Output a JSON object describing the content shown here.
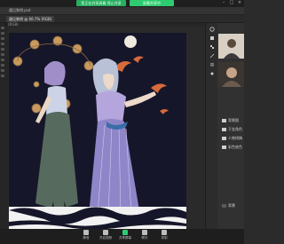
{
  "meeting_banner": {
    "left_text": "您正在共享屏幕 停止共享",
    "right_text": "屏幕共享中"
  },
  "document": {
    "title": "遇见黎明.psd",
    "tab_label": "遇见黎明 @ 66.7% (RGB)"
  },
  "ruler": {
    "unit_label": "(RGB)"
  },
  "panel": {
    "video_labels": [
      "",
      ""
    ],
    "layers": [
      {
        "label": "背景图"
      },
      {
        "label": "于女角色"
      },
      {
        "label": "人物线稿"
      },
      {
        "label": "彩色底色"
      },
      {
        "label": "背景"
      }
    ]
  },
  "bottom_bar": {
    "items": [
      {
        "label": "静音"
      },
      {
        "label": "开启视频"
      },
      {
        "label": "共享屏幕"
      },
      {
        "label": "聊天"
      },
      {
        "label": "录制"
      }
    ]
  },
  "colors": {
    "accent": "#27ae60",
    "night_sky": "#16162a",
    "dress_purple": "#8f86c9",
    "skirt_green": "#566a5d",
    "bubbles": "#c89a5e"
  }
}
